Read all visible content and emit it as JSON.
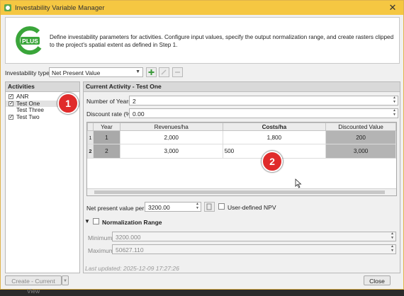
{
  "window": {
    "title": "Investability Variable Manager",
    "close_glyph": "✕"
  },
  "header": {
    "logo_text": "PLUS",
    "description": "Define investability parameters for activities. Configure input values, specify the output normalization range, and create rasters clipped to the project's spatial extent as defined in Step 1."
  },
  "toolbar": {
    "type_label": "Investability type:",
    "type_value": "Net Present Value",
    "icons": [
      "add-icon",
      "edit-icon",
      "remove-icon"
    ]
  },
  "activities": {
    "header": "Activities",
    "items": [
      {
        "label": "ANR",
        "checked": true
      },
      {
        "label": "Test One",
        "checked": true,
        "selected": true
      },
      {
        "label": "Test Three",
        "checked": false
      },
      {
        "label": "Test Two",
        "checked": true
      }
    ]
  },
  "current": {
    "header": "Current Activity - Test One",
    "years_label": "Number of Years",
    "years_value": "2",
    "discount_label": "Discount rate (%)",
    "discount_value": "0.00",
    "table": {
      "columns": [
        "Year",
        "Revenues/ha",
        "Costs/ha",
        "Discounted Value"
      ],
      "rows": [
        {
          "index": "1",
          "year": "1",
          "revenue": "2,000",
          "cost": "1,800",
          "discounted": "200"
        },
        {
          "index": "2",
          "year": "2",
          "revenue": "3,000",
          "cost": "500",
          "discounted": "3,000"
        }
      ]
    },
    "npv_label": "Net present value per ha",
    "npv_value": "3200.00",
    "user_defined_label": "User-defined NPV",
    "normalization": {
      "title": "Normalization Range",
      "min_label": "Minimum",
      "min_value": "3200.000",
      "max_label": "Maximum",
      "max_value": "50627.110"
    },
    "last_updated": "Last updated: 2025-12-09 17:27:26"
  },
  "footer": {
    "create_label": "Create - Current View",
    "close_label": "Close"
  },
  "annotations": [
    "1",
    "2"
  ],
  "colors": {
    "titlebar": "#f5c742",
    "badge": "#e02b2b",
    "logo_green": "#3aa53a"
  }
}
